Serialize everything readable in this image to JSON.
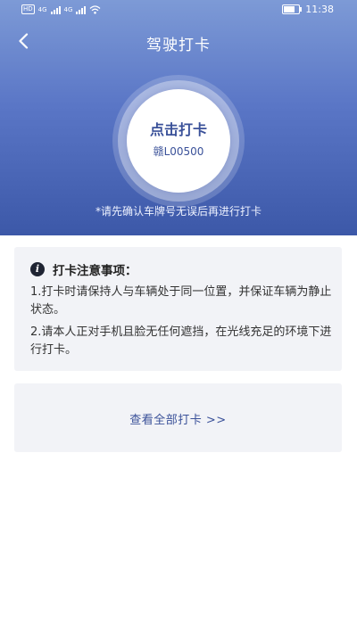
{
  "statusbar": {
    "network_badge": "HD",
    "signal1_label": "4G",
    "signal2_label": "4G",
    "time": "11:38"
  },
  "header": {
    "title": "驾驶打卡",
    "back_icon": "chevron-left-icon"
  },
  "checkin": {
    "button_label": "点击打卡",
    "plate_number": "赣L00500",
    "hint": "*请先确认车牌号无误后再进行打卡"
  },
  "notes": {
    "icon": "info-icon",
    "icon_glyph": "i",
    "title": "打卡注意事项：",
    "items": [
      "1.打卡时请保持人与车辆处于同一位置，并保证车辆为静止状态。",
      "2.请本人正对手机且脸无任何遮挡，在光线充足的环境下进行打卡。"
    ]
  },
  "view_all": {
    "label": "查看全部打卡 >>"
  },
  "colors": {
    "header_top": "#7d9ad6",
    "header_bottom": "#3c58a8",
    "accent_text": "#3a5199",
    "card_bg": "#f2f3f7"
  }
}
